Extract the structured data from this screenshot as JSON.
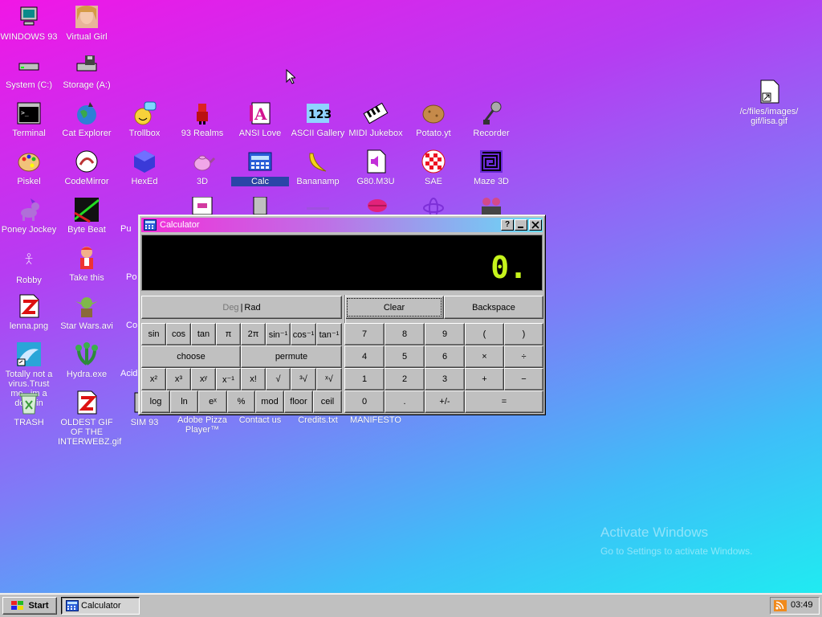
{
  "desktop": {
    "icons": [
      {
        "label": "WINDOWS 93",
        "icon": "computer-icon"
      },
      {
        "label": "Virtual Girl",
        "icon": "virtual-girl-icon"
      },
      {
        "label": "System (C:)",
        "icon": "drive-icon"
      },
      {
        "label": "Storage (A:)",
        "icon": "floppy-drive-icon"
      },
      {
        "label": "Terminal",
        "icon": "terminal-icon"
      },
      {
        "label": "Cat Explorer",
        "icon": "globe-cat-icon"
      },
      {
        "label": "Trollbox",
        "icon": "chat-face-icon"
      },
      {
        "label": "93 Realms",
        "icon": "knight-icon"
      },
      {
        "label": "ANSI Love",
        "icon": "letter-a-icon"
      },
      {
        "label": "ASCII Gallery",
        "icon": "numbers-icon"
      },
      {
        "label": "MIDI Jukebox",
        "icon": "piano-icon"
      },
      {
        "label": "Potato.yt",
        "icon": "potato-icon"
      },
      {
        "label": "Recorder",
        "icon": "microphone-icon"
      },
      {
        "label": "Piskel",
        "icon": "palette-icon"
      },
      {
        "label": "CodeMirror",
        "icon": "code-icon"
      },
      {
        "label": "HexEd",
        "icon": "cube-icon"
      },
      {
        "label": "3D",
        "icon": "teapot-icon"
      },
      {
        "label": "Calc",
        "icon": "calculator-icon"
      },
      {
        "label": "Bananamp",
        "icon": "banana-icon"
      },
      {
        "label": "G80.M3U",
        "icon": "speaker-file-icon"
      },
      {
        "label": "SAE",
        "icon": "ball-icon"
      },
      {
        "label": "Maze 3D",
        "icon": "maze-icon"
      },
      {
        "label": "Poney Jockey",
        "icon": "pony-icon"
      },
      {
        "label": "Byte Beat",
        "icon": "bytebeat-icon"
      },
      {
        "label": "Robby",
        "icon": "stick-figure-icon"
      },
      {
        "label": "Take this",
        "icon": "man-icon"
      },
      {
        "label": "lenna.png",
        "icon": "image-file-icon"
      },
      {
        "label": "Star Wars.avi",
        "icon": "yoda-icon"
      },
      {
        "label": "Totally not a virus.Trust me...im a dolphin",
        "icon": "dolphin-icon"
      },
      {
        "label": "Hydra.exe",
        "icon": "hydra-icon"
      },
      {
        "label": "TRASH",
        "icon": "trash-icon"
      },
      {
        "label": "OLDEST GIF OF THE INTERWEBZ.gif",
        "icon": "image-file-icon"
      },
      {
        "label": "SIM 93",
        "icon": "sim-icon"
      },
      {
        "label": "Adobe Pizza Player™",
        "icon": "pizza-icon"
      },
      {
        "label": "Contact us",
        "icon": "contact-icon"
      },
      {
        "label": "Credits.txt",
        "icon": "text-file-icon"
      },
      {
        "label": "MANIFESTO",
        "icon": "manifesto-icon"
      },
      {
        "label": "/c/files/images/gif/lisa.gif",
        "icon": "shortcut-file-icon"
      }
    ],
    "partial_labels": [
      "Pu",
      "Po",
      "Co",
      "Acid"
    ],
    "watermark": {
      "title": "Activate Windows",
      "subtitle": "Go to Settings to activate Windows."
    }
  },
  "calculator": {
    "title": "Calculator",
    "help_label": "?",
    "display_value": "0.",
    "angle_mode": {
      "deg": "Deg",
      "separator": "|",
      "rad": "Rad"
    },
    "clear_label": "Clear",
    "backspace_label": "Backspace",
    "sci_rows": [
      [
        "sin",
        "cos",
        "tan",
        "π",
        "2π",
        "sin⁻¹",
        "cos⁻¹",
        "tan⁻¹"
      ],
      [
        "x²",
        "x³",
        "xʸ",
        "x⁻¹",
        "x!",
        "√",
        "³√",
        "ˣ√"
      ],
      [
        "log",
        "ln",
        "eˣ",
        "%",
        "mod",
        "floor",
        "ceil"
      ]
    ],
    "choose_label": "choose",
    "permute_label": "permute",
    "num_rows": [
      [
        "7",
        "8",
        "9",
        "(",
        ")"
      ],
      [
        "4",
        "5",
        "6",
        "×",
        "÷"
      ],
      [
        "1",
        "2",
        "3",
        "+",
        "−"
      ],
      [
        "0",
        ".",
        "+/-",
        "="
      ]
    ]
  },
  "taskbar": {
    "start_label": "Start",
    "task_label": "Calculator",
    "clock": "03:49"
  },
  "colors": {
    "display_text": "#c6f41c",
    "titlebar_left": "#f22fd9",
    "titlebar_right": "#66dcf6"
  }
}
